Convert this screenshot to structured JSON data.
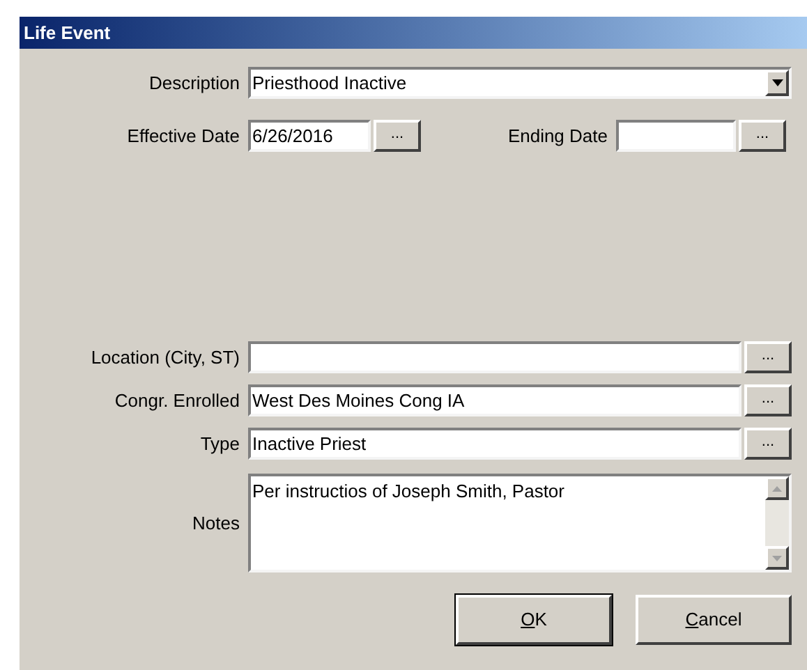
{
  "window": {
    "title": "Life Event"
  },
  "description": {
    "label": "Description",
    "value": "Priesthood Inactive"
  },
  "effective_date": {
    "label": "Effective Date",
    "value": "6/26/2016",
    "button": "..."
  },
  "ending_date": {
    "label": "Ending Date",
    "button": "..."
  },
  "lookups": [
    {
      "label": "Location (City, ST)",
      "button": "..."
    },
    {
      "label": "Congr. Enrolled",
      "value": "West Des Moines Cong IA",
      "button": "..."
    },
    {
      "label": "Type",
      "value": "Inactive Priest",
      "button": "..."
    }
  ],
  "notes": {
    "label": "Notes",
    "value": "Per instructios of Joseph Smith, Pastor"
  },
  "buttons": [
    {
      "label": "OK",
      "default": true
    },
    {
      "label": "Cancel",
      "default": false
    }
  ]
}
